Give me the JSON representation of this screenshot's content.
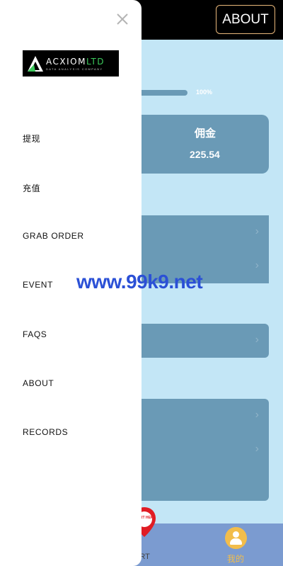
{
  "header": {
    "about_button": "ABOUT"
  },
  "progress": {
    "label": "100%",
    "value": 100
  },
  "commission_card": {
    "label": "佣金",
    "value": "225.54"
  },
  "bottom_nav": {
    "cart_badge": "START HERE",
    "cart_label": "ART",
    "mine_label": "我的"
  },
  "drawer": {
    "logo": {
      "name_main": "ACXIOM",
      "name_suffix": "LTD",
      "tagline": "DATA ANALYSIS COMPANY"
    },
    "menu": [
      {
        "label": "提现"
      },
      {
        "label": "充值"
      },
      {
        "label": "GRAB ORDER"
      },
      {
        "label": "EVENT"
      },
      {
        "label": "FAQS"
      },
      {
        "label": "ABOUT"
      },
      {
        "label": "RECORDS"
      }
    ]
  },
  "watermark": "www.99k9.net",
  "colors": {
    "page_bg": "#c3e6f6",
    "card_bg": "#6a9ab6",
    "accent_gold": "#f2bd4b",
    "watermark_blue": "#2b50d6",
    "logo_green": "#3cc95c"
  }
}
